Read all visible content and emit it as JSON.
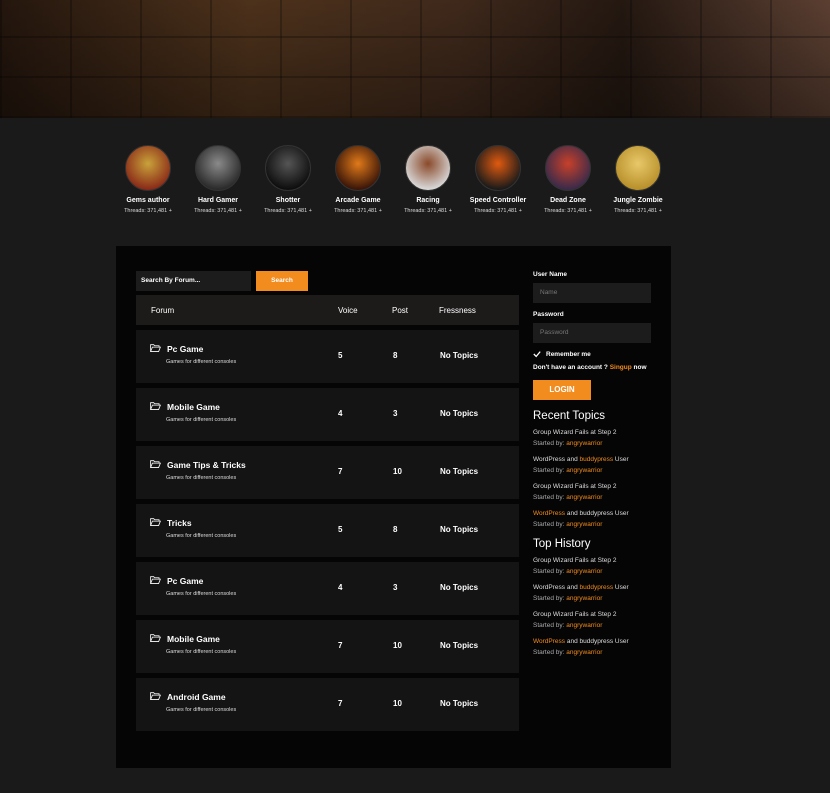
{
  "authors": [
    {
      "name": "Gems author",
      "threads": "Threads: 371,481 +",
      "color_a": "#8a2a18",
      "color_b": "#c9a23a"
    },
    {
      "name": "Hard Gamer",
      "threads": "Threads: 371,481 +",
      "color_a": "#2a2a2a",
      "color_b": "#8a8a8a"
    },
    {
      "name": "Shotter",
      "threads": "Threads: 371,481 +",
      "color_a": "#0d0d0d",
      "color_b": "#555555"
    },
    {
      "name": "Arcade Game",
      "threads": "Threads: 371,481 +",
      "color_a": "#3a1508",
      "color_b": "#e07a1a"
    },
    {
      "name": "Racing",
      "threads": "Threads: 371,481 +",
      "color_a": "#d9d9d9",
      "color_b": "#8a4a2a"
    },
    {
      "name": "Speed Controller",
      "threads": "Threads: 371,481 +",
      "color_a": "#1a1a1a",
      "color_b": "#e05a10"
    },
    {
      "name": "Dead Zone",
      "threads": "Threads: 371,481 +",
      "color_a": "#3a2a4a",
      "color_b": "#c8402a"
    },
    {
      "name": "Jungle Zombie",
      "threads": "Threads: 371,481 +",
      "color_a": "#b8902a",
      "color_b": "#e8c86a"
    }
  ],
  "search": {
    "placeholder": "Search By Forum...",
    "button": "Search"
  },
  "table": {
    "headers": {
      "forum": "Forum",
      "voice": "Voice",
      "post": "Post",
      "freshness": "Fressness"
    },
    "rows": [
      {
        "name": "Pc Game",
        "desc": "Games for different consoles",
        "voice": "5",
        "post": "8",
        "freshness": "No Topics"
      },
      {
        "name": "Mobile Game",
        "desc": "Games for different consoles",
        "voice": "4",
        "post": "3",
        "freshness": "No Topics"
      },
      {
        "name": "Game Tips & Tricks",
        "desc": "Games for different consoles",
        "voice": "7",
        "post": "10",
        "freshness": "No Topics"
      },
      {
        "name": "Tricks",
        "desc": "Games for different consoles",
        "voice": "5",
        "post": "8",
        "freshness": "No Topics"
      },
      {
        "name": "Pc Game",
        "desc": "Games for different consoles",
        "voice": "4",
        "post": "3",
        "freshness": "No Topics"
      },
      {
        "name": "Mobile Game",
        "desc": "Games for different consoles",
        "voice": "7",
        "post": "10",
        "freshness": "No Topics"
      },
      {
        "name": "Android Game",
        "desc": "Games for different consoles",
        "voice": "7",
        "post": "10",
        "freshness": "No Topics"
      }
    ]
  },
  "login": {
    "username_label": "User Name",
    "username_placeholder": "Name",
    "password_label": "Password",
    "password_placeholder": "Password",
    "remember": "Remember me",
    "no_account": "Don't have an account ?",
    "signup": "Singup",
    "now": "now",
    "button": "LOGIN"
  },
  "recent_topics": {
    "title": "Recent Topics",
    "items": [
      {
        "pre": "Group Wizard Fails at Step 2",
        "hl": "",
        "post": "",
        "started": "Started by:",
        "author": "angrywarrior",
        "hl_first": false
      },
      {
        "pre": "WordPress and ",
        "hl": "buddypress",
        "post": " User",
        "started": "Started by:",
        "author": "angrywarrior",
        "hl_first": false
      },
      {
        "pre": "Group Wizard Fails at Step 2",
        "hl": "",
        "post": "",
        "started": "Started by:",
        "author": "angrywarrior",
        "hl_first": false
      },
      {
        "pre": "",
        "hl": "WordPress",
        "post": " and buddypress User",
        "started": "Started by:",
        "author": "angrywarrior",
        "hl_first": true
      }
    ]
  },
  "top_history": {
    "title": "Top History",
    "items": [
      {
        "pre": "Group Wizard Fails at Step 2",
        "hl": "",
        "post": "",
        "started": "Started by:",
        "author": "angrywarrior",
        "hl_first": false
      },
      {
        "pre": "WordPress and ",
        "hl": "buddypress",
        "post": " User",
        "started": "Started by:",
        "author": "angrywarrior",
        "hl_first": false
      },
      {
        "pre": "Group Wizard Fails at Step 2",
        "hl": "",
        "post": "",
        "started": "Started by:",
        "author": "angrywarrior",
        "hl_first": false
      },
      {
        "pre": "",
        "hl": "WordPress",
        "post": " and buddypress User",
        "started": "Started by:",
        "author": "angrywarrior",
        "hl_first": true
      }
    ]
  },
  "colors": {
    "accent": "#f28c1f"
  }
}
